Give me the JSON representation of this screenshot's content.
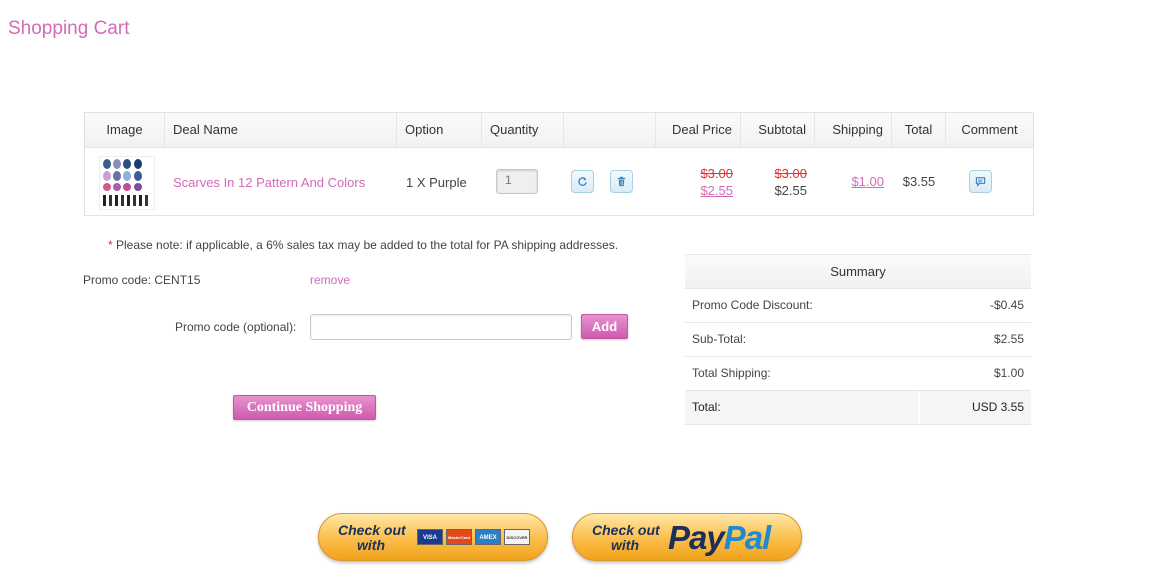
{
  "page": {
    "title": "Shopping Cart"
  },
  "table": {
    "headers": {
      "image": "Image",
      "deal_name": "Deal Name",
      "option": "Option",
      "quantity": "Quantity",
      "actions": "",
      "deal_price": "Deal Price",
      "subtotal": "Subtotal",
      "shipping": "Shipping",
      "total": "Total",
      "comment": "Comment"
    },
    "rows": [
      {
        "deal_name": "Scarves In 12 Pattern And Colors",
        "option": "1 X Purple",
        "quantity": "1",
        "deal_price_original": "$3.00",
        "deal_price": "$2.55",
        "subtotal_original": "$3.00",
        "subtotal": "$2.55",
        "shipping": "$1.00",
        "total": "$3.55"
      }
    ]
  },
  "note": {
    "star": "*",
    "text": "Please note: if applicable, a 6% sales tax may be added to the total for PA shipping addresses."
  },
  "promo": {
    "applied": "Promo code: CENT15",
    "remove_label": "remove",
    "input_label": "Promo code (optional):",
    "input_value": "",
    "add_label": "Add"
  },
  "continue_label": "Continue Shopping",
  "summary": {
    "title": "Summary",
    "rows": [
      {
        "label": "Promo Code Discount:",
        "value": "-$0.45"
      },
      {
        "label": "Sub-Total:",
        "value": "$2.55"
      },
      {
        "label": "Total Shipping:",
        "value": "$1.00"
      }
    ],
    "total": {
      "label": "Total:",
      "value": "USD 3.55"
    }
  },
  "checkout": {
    "cards": {
      "line1": "Check out",
      "line2": "with",
      "brands": [
        "VISA",
        "MasterCard",
        "AMEX",
        "DISCOVER"
      ]
    },
    "paypal": {
      "line1": "Check out",
      "line2": "with",
      "logo_pay": "Pay",
      "logo_pal": "Pal"
    }
  },
  "colors": {
    "accent_pink": "#d46ab8",
    "strike_red": "#dd3333",
    "paypal_dark": "#1c2f5a",
    "paypal_light": "#1e8bd0"
  }
}
